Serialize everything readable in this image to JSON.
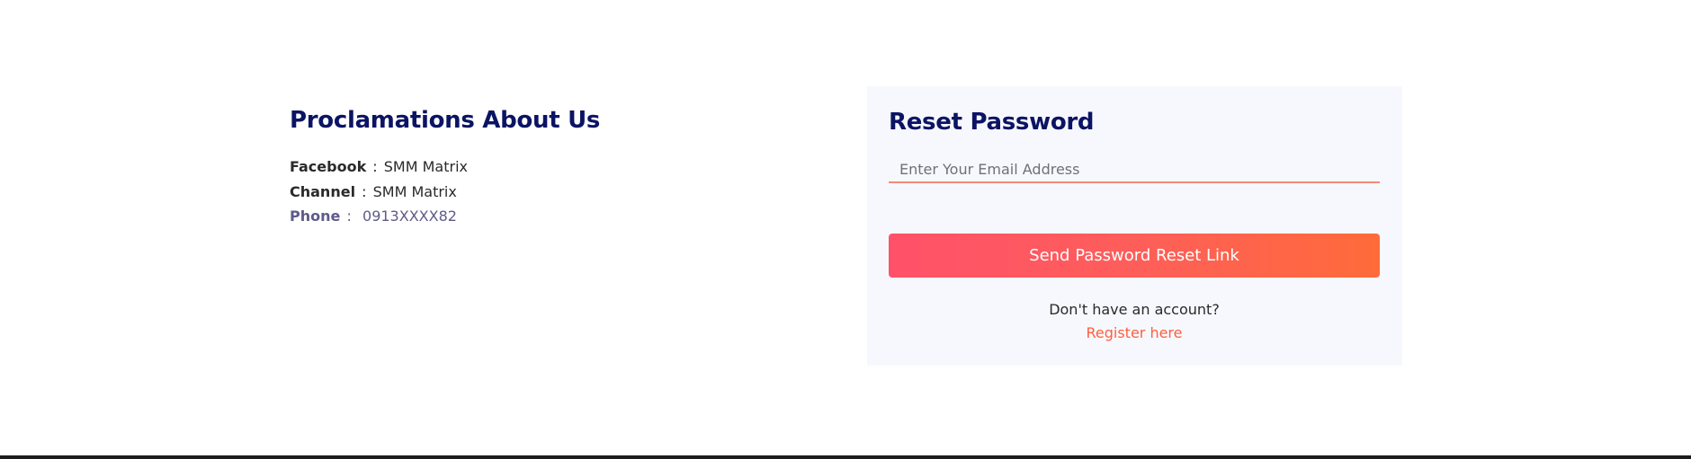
{
  "about": {
    "title": "Proclamations About Us",
    "contacts": [
      {
        "key": "Facebook",
        "sep": " : ",
        "value": "SMM Matrix"
      },
      {
        "key": "Channel",
        "sep": " : ",
        "value": "SMM Matrix"
      },
      {
        "key": "Phone",
        "sep": " :  ",
        "value": "0913XXXX82"
      }
    ]
  },
  "reset": {
    "title": "Reset Password",
    "email_placeholder": "Enter Your Email Address",
    "email_value": "",
    "submit_label": "Send Password Reset Link",
    "no_account_text": "Don't have an account?",
    "register_link": "Register here"
  },
  "colors": {
    "heading": "#0b1464",
    "accent": "#fe5e3f",
    "button_gradient_start": "#ff5169",
    "button_gradient_end": "#ff6b3a",
    "card_bg": "#f7f8fd",
    "phone_text": "#5e5a8a"
  }
}
